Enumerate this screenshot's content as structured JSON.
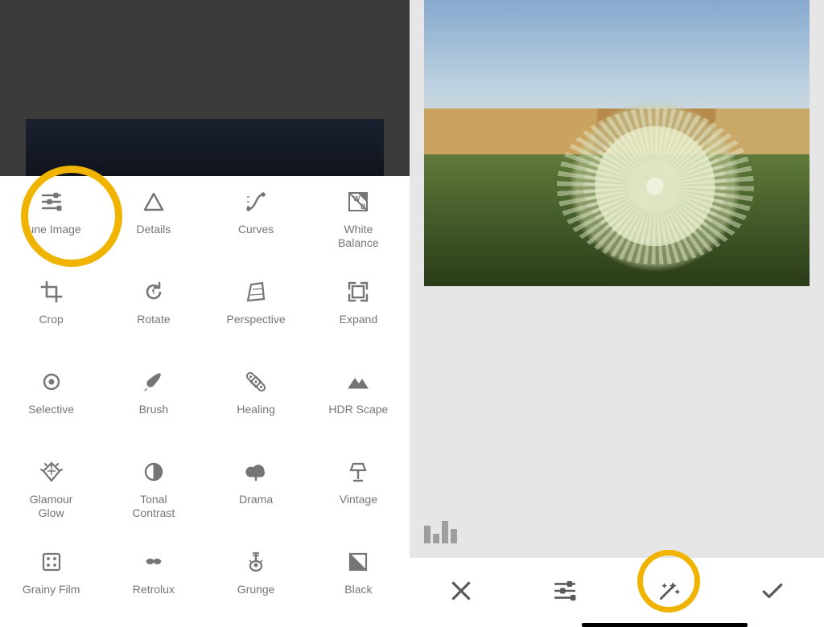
{
  "highlight_color": "#f0b400",
  "left": {
    "tools": [
      {
        "id": "tune-image",
        "label": "Tune Image",
        "icon": "sliders"
      },
      {
        "id": "details",
        "label": "Details",
        "icon": "triangle"
      },
      {
        "id": "curves",
        "label": "Curves",
        "icon": "curves"
      },
      {
        "id": "white-balance",
        "label": "White\nBalance",
        "icon": "wb"
      },
      {
        "id": "crop",
        "label": "Crop",
        "icon": "crop"
      },
      {
        "id": "rotate",
        "label": "Rotate",
        "icon": "rotate"
      },
      {
        "id": "perspective",
        "label": "Perspective",
        "icon": "perspective"
      },
      {
        "id": "expand",
        "label": "Expand",
        "icon": "expand"
      },
      {
        "id": "selective",
        "label": "Selective",
        "icon": "target"
      },
      {
        "id": "brush",
        "label": "Brush",
        "icon": "brush"
      },
      {
        "id": "healing",
        "label": "Healing",
        "icon": "bandage"
      },
      {
        "id": "hdr-scape",
        "label": "HDR Scape",
        "icon": "mountains"
      },
      {
        "id": "glamour-glow",
        "label": "Glamour\nGlow",
        "icon": "diamond"
      },
      {
        "id": "tonal-contrast",
        "label": "Tonal\nContrast",
        "icon": "half-circle"
      },
      {
        "id": "drama",
        "label": "Drama",
        "icon": "cloud"
      },
      {
        "id": "vintage",
        "label": "Vintage",
        "icon": "lamp"
      },
      {
        "id": "grainy-film",
        "label": "Grainy Film",
        "icon": "film"
      },
      {
        "id": "retrolux",
        "label": "Retrolux",
        "icon": "mustache"
      },
      {
        "id": "grunge",
        "label": "Grunge",
        "icon": "guitar"
      },
      {
        "id": "black",
        "label": "Black",
        "icon": "contrast-sq"
      }
    ],
    "highlighted_tool": "tune-image"
  },
  "right": {
    "histogram_icon": "histogram-icon",
    "toolbar": [
      {
        "id": "cancel",
        "icon": "close"
      },
      {
        "id": "tune",
        "icon": "sliders"
      },
      {
        "id": "auto",
        "icon": "wand"
      },
      {
        "id": "apply",
        "icon": "check"
      }
    ],
    "highlighted_button": "auto",
    "active_underline_button": "auto"
  }
}
